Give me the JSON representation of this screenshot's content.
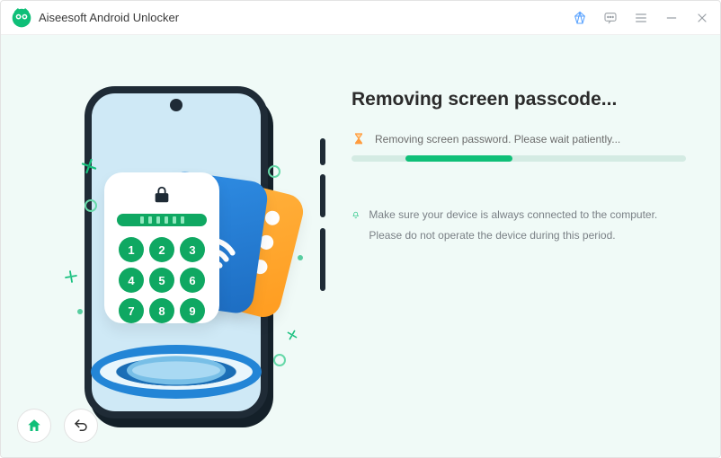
{
  "titlebar": {
    "app_name": "Aiseesoft Android Unlocker"
  },
  "main": {
    "heading": "Removing screen passcode...",
    "status": "Removing screen password. Please wait patiently...",
    "hint": "Make sure your device is always connected to the computer. Please do not operate the device during this period."
  },
  "keypad": [
    "1",
    "2",
    "3",
    "4",
    "5",
    "6",
    "7",
    "8",
    "9"
  ]
}
